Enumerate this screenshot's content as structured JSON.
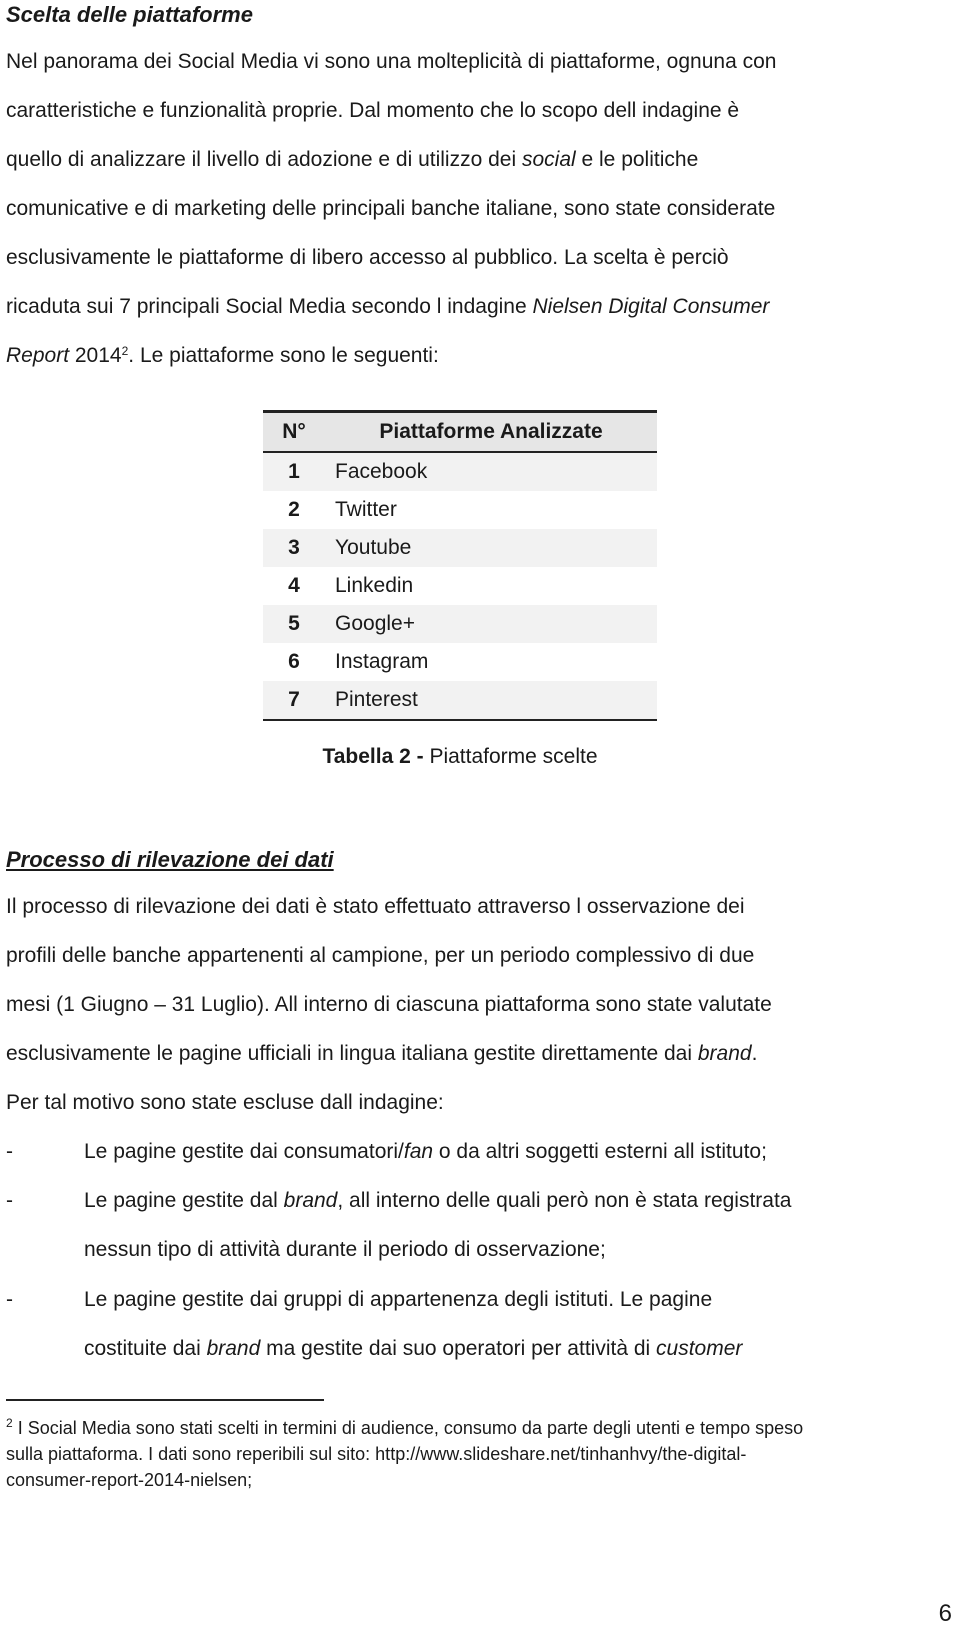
{
  "section1": {
    "title": "Scelta delle piattaforme",
    "paragraph_lines": [
      [
        "Nel panorama dei Social Media vi sono una molteplicità di piattaforme, ognuna con"
      ],
      [
        "caratteristiche e funzionalità proprie. Dal momento che lo scopo dell indagine è"
      ],
      [
        "quello di analizzare il livello di adozione e di utilizzo dei ",
        "social",
        " e le politiche"
      ],
      [
        "comunicative e di marketing delle principali banche italiane, sono state considerate"
      ],
      [
        "esclusivamente le piattaforme di libero accesso al pubblico. La scelta è perciò"
      ],
      [
        "ricaduta sui 7 principali Social Media secondo l indagine ",
        "Nielsen Digital Consumer"
      ],
      [
        "Report",
        " 2014",
        "2",
        ". Le piattaforme sono le seguenti:"
      ]
    ]
  },
  "table": {
    "headers": [
      "N°",
      "Piattaforme Analizzate"
    ],
    "rows": [
      {
        "n": "1",
        "name": "Facebook"
      },
      {
        "n": "2",
        "name": "Twitter"
      },
      {
        "n": "3",
        "name": "Youtube"
      },
      {
        "n": "4",
        "name": "Linkedin"
      },
      {
        "n": "5",
        "name": "Google+"
      },
      {
        "n": "6",
        "name": "Instagram"
      },
      {
        "n": "7",
        "name": "Pinterest"
      }
    ],
    "caption_label": "Tabella 2 -",
    "caption_text": " Piattaforme scelte"
  },
  "section2": {
    "title": "Processo di rilevazione dei dati",
    "lines": [
      "Il processo di rilevazione dei dati è stato effettuato attraverso l osservazione dei",
      "profili delle banche appartenenti al campione, per un periodo complessivo di due",
      "mesi (1 Giugno – 31 Luglio). All interno di ciascuna piattaforma sono state valutate",
      [
        "esclusivamente le pagine ufficiali in lingua italiana gestite direttamente dai ",
        "brand",
        "."
      ],
      "Per tal motivo sono state escluse dall indagine:"
    ],
    "bullets": [
      {
        "dash": "-",
        "lines": [
          [
            "Le pagine gestite dai consumatori/",
            "fan",
            " o da altri soggetti esterni all istituto;"
          ]
        ]
      },
      {
        "dash": "-",
        "lines": [
          [
            "Le pagine gestite dal ",
            "brand",
            ", all interno delle quali però non è stata registrata"
          ],
          [
            "nessun tipo di attività durante il periodo di osservazione;"
          ]
        ]
      },
      {
        "dash": "-",
        "lines": [
          [
            "Le pagine gestite dai gruppi di appartenenza degli istituti. Le pagine"
          ],
          [
            "costituite dai ",
            "brand",
            " ma gestite dai suo operatori per attività di ",
            "customer"
          ]
        ]
      }
    ]
  },
  "footnote": {
    "marker": "2",
    "lines": [
      " I Social Media sono stati scelti in termini di audience, consumo da parte degli utenti e tempo speso",
      "sulla piattaforma. I dati sono reperibili sul sito: http://www.slideshare.net/tinhanhvy/the-digital-",
      "consumer-report-2014-nielsen;"
    ]
  },
  "page_number": "6"
}
